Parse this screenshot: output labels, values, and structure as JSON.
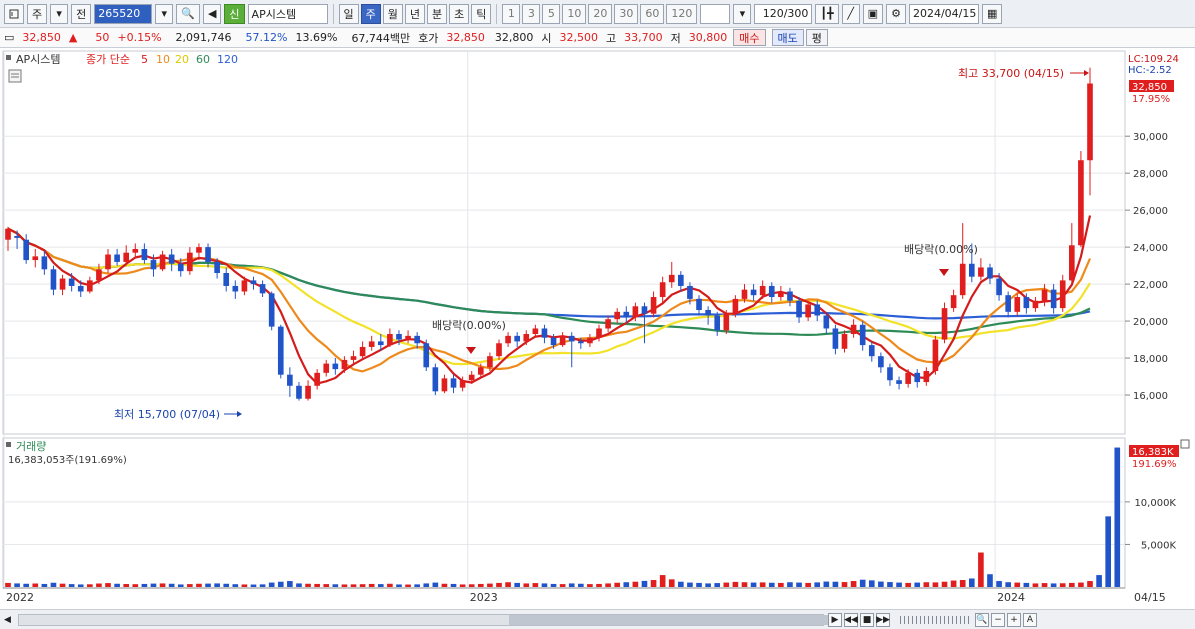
{
  "toolbar": {
    "market": "주",
    "prefix": "전",
    "code": "265520",
    "badge": "신",
    "stock_name": "AP시스템",
    "periods": [
      "일",
      "주",
      "월",
      "년",
      "분",
      "초",
      "틱"
    ],
    "active_period": "주",
    "counts": [
      "1",
      "3",
      "5",
      "10",
      "20",
      "30",
      "60",
      "120"
    ],
    "bar_count": "120",
    "bar_total": "/300",
    "date": "2024/04/15"
  },
  "infobar": {
    "price": "32,850",
    "change": "50",
    "change_pct": "+0.15%",
    "volume": "2,091,746",
    "ratio1": "57.12%",
    "ratio2": "13.69%",
    "amount": "67,744백만",
    "bid_label": "호가",
    "bid1": "32,850",
    "bid2": "32,800",
    "open_label": "시",
    "open": "32,500",
    "high_label": "고",
    "high": "33,700",
    "low_label": "저",
    "low": "30,800",
    "buy": "매수",
    "sell": "매도",
    "eval": "평"
  },
  "legend": {
    "stock": "AP시스템",
    "ma_label": "종가 단순",
    "ma_periods": [
      "5",
      "10",
      "20",
      "60",
      "120"
    ]
  },
  "colors": {
    "up": "#e01e1e",
    "down": "#2154c9",
    "ma5": "#d41c1c",
    "ma10": "#ee8a1c",
    "ma20": "#f2e22a",
    "ma60": "#2e8b57",
    "ma120": "#2c5fd6"
  },
  "right_panel": {
    "lc": "LC:109.24",
    "hc": "HC:-2.52",
    "price_tag": "32,850",
    "pct_tag": "17.95%",
    "vol_tag": "16,383K",
    "vol_pct_tag": "191.69%"
  },
  "annotations": {
    "high": "최고 33,700 (04/15)",
    "low": "최저 15,700 (07/04)",
    "dividend1": "배당락(0.00%)",
    "dividend2": "배당락(0.00%)"
  },
  "volume_panel": {
    "title": "거래량",
    "value": "16,383,053주(191.69%)"
  },
  "x_labels": [
    "2022",
    "2023",
    "2024",
    "04/15"
  ],
  "chart_data": {
    "type": "candlestick",
    "price_axis": {
      "ticks": [
        16000,
        18000,
        20000,
        22000,
        24000,
        26000,
        28000,
        30000
      ],
      "tick_labels": [
        "16,000",
        "18,000",
        "20,000",
        "22,000",
        "24,000",
        "26,000",
        "28,000",
        "30,000"
      ]
    },
    "volume_axis": {
      "ticks": [
        5000,
        10000
      ],
      "tick_labels": [
        "5,000K",
        "10,000K"
      ]
    },
    "candles": [
      [
        24400,
        25000,
        23800,
        25100
      ],
      [
        24600,
        24500,
        23900,
        24900
      ],
      [
        24400,
        23300,
        23100,
        24700
      ],
      [
        23300,
        23500,
        22900,
        23900
      ],
      [
        23500,
        22800,
        22500,
        23800
      ],
      [
        22800,
        21700,
        21400,
        23000
      ],
      [
        21700,
        22300,
        21400,
        22500
      ],
      [
        22300,
        21900,
        21600,
        22600
      ],
      [
        21900,
        21600,
        21300,
        22200
      ],
      [
        21600,
        22200,
        21500,
        22400
      ],
      [
        22200,
        22800,
        22000,
        23100
      ],
      [
        22800,
        23600,
        22600,
        23900
      ],
      [
        23600,
        23200,
        23000,
        23900
      ],
      [
        23200,
        23700,
        23000,
        24100
      ],
      [
        23700,
        23900,
        23400,
        24200
      ],
      [
        23900,
        23300,
        23100,
        24200
      ],
      [
        23300,
        22800,
        22400,
        23600
      ],
      [
        22800,
        23600,
        22700,
        23800
      ],
      [
        23600,
        23100,
        22700,
        23900
      ],
      [
        23100,
        22700,
        22400,
        23400
      ],
      [
        22700,
        23700,
        22500,
        24000
      ],
      [
        23700,
        24000,
        23300,
        24200
      ],
      [
        24000,
        23200,
        22900,
        24200
      ],
      [
        23200,
        22600,
        22300,
        23400
      ],
      [
        22600,
        21900,
        21600,
        22900
      ],
      [
        21900,
        21600,
        21200,
        22200
      ],
      [
        21600,
        22200,
        21400,
        22400
      ],
      [
        22200,
        22000,
        21700,
        22400
      ],
      [
        22000,
        21500,
        21300,
        22200
      ],
      [
        21500,
        19700,
        19500,
        21600
      ],
      [
        19700,
        17100,
        16900,
        19800
      ],
      [
        17100,
        16500,
        15900,
        17500
      ],
      [
        16500,
        15800,
        15700,
        16700
      ],
      [
        15800,
        16500,
        15700,
        16800
      ],
      [
        16500,
        17200,
        16300,
        17400
      ],
      [
        17200,
        17700,
        17000,
        17900
      ],
      [
        17700,
        17400,
        17100,
        18000
      ],
      [
        17400,
        17900,
        17200,
        18100
      ],
      [
        17900,
        18100,
        17700,
        18400
      ],
      [
        18100,
        18600,
        17900,
        18900
      ],
      [
        18600,
        18900,
        18400,
        19200
      ],
      [
        18900,
        18700,
        18400,
        19300
      ],
      [
        18700,
        19300,
        18600,
        19600
      ],
      [
        19300,
        19000,
        18700,
        19500
      ],
      [
        19000,
        19200,
        18800,
        19500
      ],
      [
        19200,
        18800,
        18500,
        19400
      ],
      [
        18800,
        17500,
        17300,
        19000
      ],
      [
        17500,
        16200,
        16000,
        17700
      ],
      [
        16200,
        16900,
        16100,
        17100
      ],
      [
        16900,
        16400,
        16100,
        17100
      ],
      [
        16400,
        16800,
        16200,
        17000
      ],
      [
        16800,
        17100,
        16600,
        17300
      ],
      [
        17100,
        17500,
        16900,
        17700
      ],
      [
        17500,
        18100,
        17300,
        18300
      ],
      [
        18100,
        18800,
        17900,
        19000
      ],
      [
        18800,
        19200,
        18600,
        19400
      ],
      [
        19200,
        18900,
        18600,
        19400
      ],
      [
        18900,
        19300,
        18700,
        19500
      ],
      [
        19300,
        19600,
        19100,
        19800
      ],
      [
        19600,
        19100,
        18800,
        19800
      ],
      [
        19100,
        18700,
        18500,
        19300
      ],
      [
        18700,
        19200,
        18600,
        19400
      ],
      [
        19200,
        18900,
        17500,
        19400
      ],
      [
        18900,
        18800,
        18500,
        19100
      ],
      [
        18800,
        19100,
        18600,
        19300
      ],
      [
        19100,
        19600,
        18900,
        19800
      ],
      [
        19600,
        20100,
        19400,
        20300
      ],
      [
        20100,
        20500,
        19900,
        20700
      ],
      [
        20500,
        20200,
        19900,
        20800
      ],
      [
        20200,
        20800,
        20000,
        21000
      ],
      [
        20800,
        20400,
        18800,
        21000
      ],
      [
        20400,
        21300,
        20200,
        21600
      ],
      [
        21300,
        22100,
        21000,
        22400
      ],
      [
        22100,
        22500,
        21800,
        23200
      ],
      [
        22500,
        21900,
        21600,
        22700
      ],
      [
        21900,
        21200,
        20900,
        22100
      ],
      [
        21200,
        20600,
        20300,
        21400
      ],
      [
        20600,
        20300,
        19800,
        20800
      ],
      [
        20300,
        19500,
        19200,
        20500
      ],
      [
        19500,
        20400,
        19300,
        20600
      ],
      [
        20400,
        21200,
        20200,
        21400
      ],
      [
        21200,
        21700,
        21000,
        22000
      ],
      [
        21700,
        21400,
        21100,
        22000
      ],
      [
        21400,
        21900,
        21200,
        22200
      ],
      [
        21900,
        21300,
        21000,
        22100
      ],
      [
        21300,
        21600,
        21100,
        21900
      ],
      [
        21600,
        21100,
        20800,
        21800
      ],
      [
        21100,
        20200,
        19900,
        21300
      ],
      [
        20200,
        20900,
        20000,
        21100
      ],
      [
        20900,
        20300,
        20000,
        21100
      ],
      [
        20300,
        19600,
        19300,
        20500
      ],
      [
        19600,
        18500,
        18200,
        19800
      ],
      [
        18500,
        19300,
        18300,
        19500
      ],
      [
        19300,
        19800,
        19100,
        20100
      ],
      [
        19800,
        18700,
        18400,
        20000
      ],
      [
        18700,
        18100,
        17800,
        18900
      ],
      [
        18100,
        17500,
        17200,
        18300
      ],
      [
        17500,
        16800,
        16500,
        17700
      ],
      [
        16800,
        16600,
        16300,
        17000
      ],
      [
        16600,
        17200,
        16400,
        17400
      ],
      [
        17200,
        16700,
        16400,
        17400
      ],
      [
        16700,
        17300,
        16500,
        17500
      ],
      [
        17300,
        19000,
        17100,
        19200
      ],
      [
        19000,
        20700,
        18800,
        21000
      ],
      [
        20700,
        21400,
        20500,
        21700
      ],
      [
        21400,
        23100,
        21200,
        25300
      ],
      [
        23100,
        22400,
        22100,
        24200
      ],
      [
        22400,
        22900,
        22200,
        23400
      ],
      [
        22900,
        22300,
        22000,
        23100
      ],
      [
        22300,
        21400,
        21100,
        22600
      ],
      [
        21400,
        20500,
        20200,
        21600
      ],
      [
        20500,
        21300,
        20300,
        21500
      ],
      [
        21300,
        20700,
        20400,
        21500
      ],
      [
        20700,
        21100,
        20500,
        21300
      ],
      [
        21100,
        21700,
        20800,
        22000
      ],
      [
        21700,
        20700,
        20400,
        22000
      ],
      [
        20700,
        22200,
        20500,
        22500
      ],
      [
        22200,
        24100,
        22000,
        25300
      ],
      [
        24100,
        28700,
        24000,
        29200
      ],
      [
        28700,
        32850,
        26800,
        33700
      ]
    ],
    "volume_k": [
      480,
      420,
      380,
      410,
      360,
      500,
      390,
      340,
      300,
      320,
      410,
      460,
      380,
      350,
      330,
      360,
      400,
      420,
      380,
      300,
      340,
      380,
      400,
      420,
      380,
      330,
      300,
      290,
      310,
      520,
      620,
      700,
      420,
      380,
      360,
      340,
      320,
      300,
      310,
      330,
      360,
      340,
      380,
      300,
      290,
      310,
      420,
      520,
      380,
      360,
      300,
      320,
      360,
      400,
      480,
      560,
      480,
      420,
      460,
      420,
      360,
      340,
      420,
      380,
      340,
      360,
      420,
      500,
      560,
      620,
      720,
      820,
      1400,
      900,
      620,
      520,
      480,
      420,
      460,
      520,
      600,
      560,
      520,
      540,
      500,
      480,
      560,
      520,
      480,
      540,
      640,
      620,
      580,
      700,
      860,
      780,
      640,
      580,
      520,
      480,
      520,
      560,
      540,
      620,
      760,
      820,
      1000,
      4050,
      1500,
      700,
      560,
      520,
      480,
      420,
      460,
      420,
      440,
      480,
      520,
      700,
      1400,
      8300,
      16383
    ],
    "annotations": [
      "최고 33,700 (04/15)",
      "최저 15,700 (07/04)",
      "배당락(0.00%)",
      "배당락(0.00%)"
    ]
  }
}
